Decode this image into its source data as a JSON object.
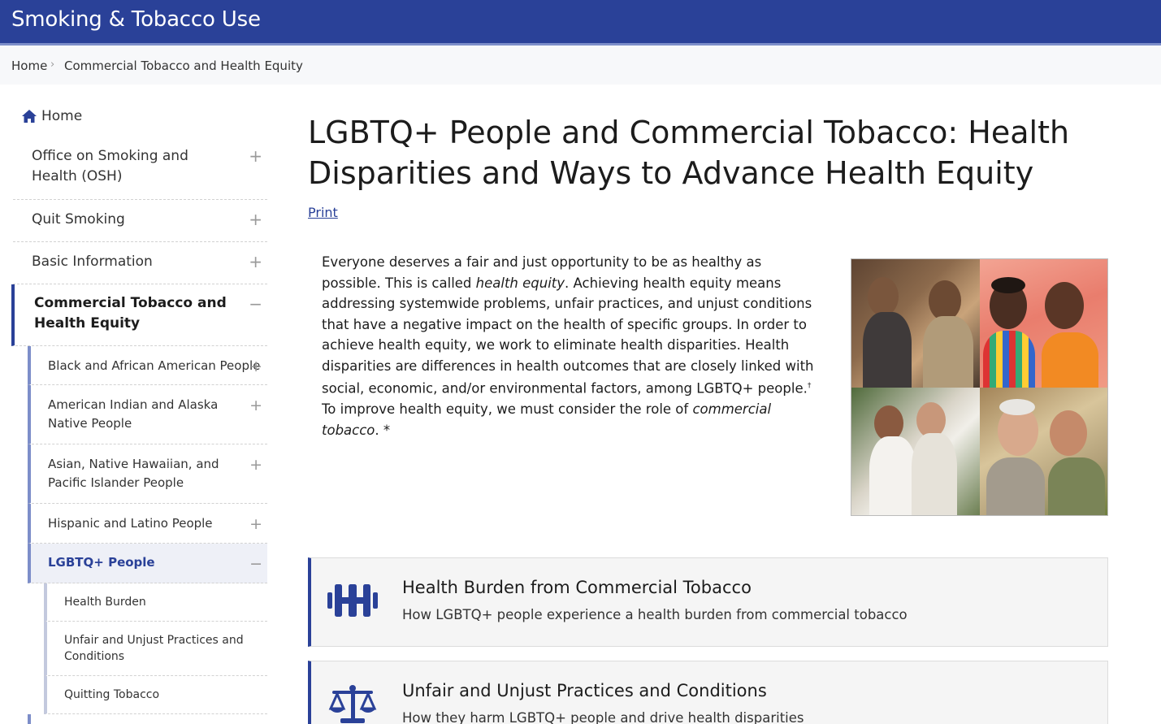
{
  "header": {
    "title": "Smoking & Tobacco Use"
  },
  "breadcrumb": {
    "home": "Home",
    "separator": "›",
    "current": "Commercial Tobacco and Health Equity"
  },
  "nav": {
    "home": "Home",
    "items": [
      {
        "label": "Office on Smoking and Health (OSH)",
        "toggle": "+"
      },
      {
        "label": "Quit Smoking",
        "toggle": "+"
      },
      {
        "label": "Basic Information",
        "toggle": "+"
      },
      {
        "label": "Commercial Tobacco and Health Equity",
        "toggle": "−"
      }
    ],
    "sub_items": [
      {
        "label": "Black and African American People",
        "toggle": "+"
      },
      {
        "label": "American Indian and Alaska Native People",
        "toggle": "+"
      },
      {
        "label": "Asian, Native Hawaiian, and Pacific Islander People",
        "toggle": "+"
      },
      {
        "label": "Hispanic and Latino People",
        "toggle": "+"
      },
      {
        "label": "LGBTQ+ People",
        "toggle": "−"
      }
    ],
    "subsub_items": [
      {
        "label": "Health Burden"
      },
      {
        "label": "Unfair and Unjust Practices and Conditions"
      },
      {
        "label": "Quitting Tobacco"
      }
    ]
  },
  "main": {
    "title": "LGBTQ+ People and Commercial Tobacco: Health Disparities and Ways to Advance Health Equity",
    "print": "Print",
    "intro": {
      "p1": "Everyone deserves a fair and just opportunity to be as healthy as possible. This is called ",
      "em1": "health equity",
      "p2": ". Achieving health equity means addressing systemwide problems, unfair practices, and unjust conditions that have a negative impact on the health of specific groups. In order to achieve health equity, we work to eliminate health disparities. Health disparities are differences in health outcomes that are closely linked with social, economic, and/or environmental factors, among LGBTQ+ people.",
      "sup": "†",
      "p3": " To improve health equity, we must consider the role of ",
      "em2": "commercial tobacco",
      "p4": ". *"
    },
    "cards": [
      {
        "title": "Health Burden from Commercial Tobacco",
        "subtitle": "How LGBTQ+ people experience a health burden from commercial tobacco",
        "icon": "dumbbell-icon"
      },
      {
        "title": "Unfair and Unjust Practices and Conditions",
        "subtitle": "How they harm LGBTQ+ people and drive health disparities",
        "icon": "scales-icon"
      }
    ]
  },
  "colors": {
    "brand": "#2a4198",
    "accent_light": "#7d8ec9",
    "breadcrumb_bg": "#f7f8fa",
    "card_bg": "#f5f5f5"
  }
}
